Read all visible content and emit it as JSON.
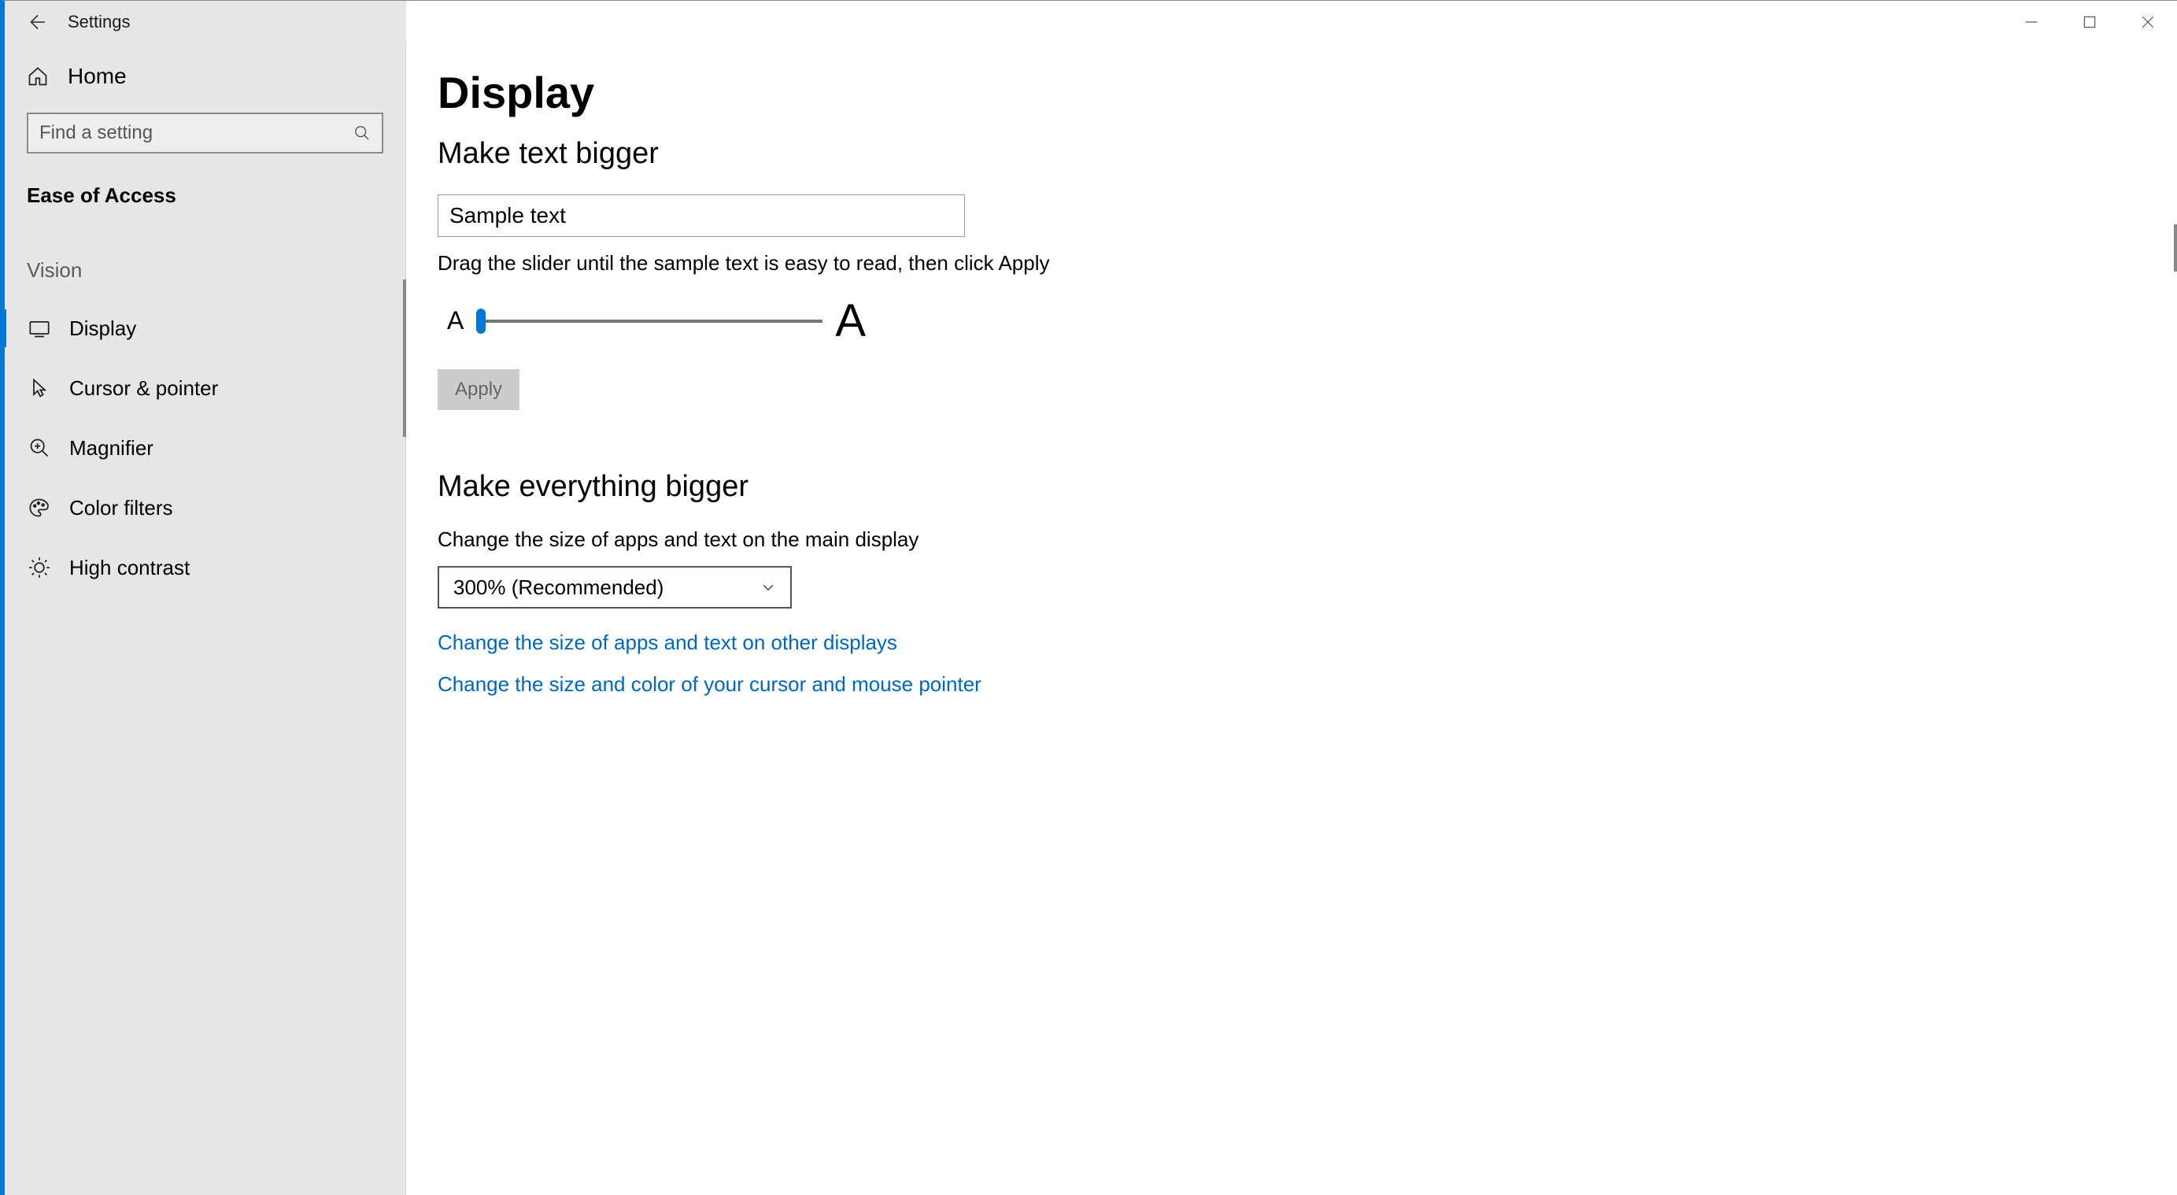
{
  "titlebar": {
    "app_title": "Settings"
  },
  "sidebar": {
    "home_label": "Home",
    "search_placeholder": "Find a setting",
    "category": "Ease of Access",
    "section_vision": "Vision",
    "items": [
      {
        "label": "Display",
        "active": true
      },
      {
        "label": "Cursor & pointer",
        "active": false
      },
      {
        "label": "Magnifier",
        "active": false
      },
      {
        "label": "Color filters",
        "active": false
      },
      {
        "label": "High contrast",
        "active": false
      }
    ]
  },
  "content": {
    "page_title": "Display",
    "section1": {
      "heading": "Make text bigger",
      "sample_text": "Sample text",
      "instruction": "Drag the slider until the sample text is easy to read, then click Apply",
      "small_a": "A",
      "big_a": "A",
      "apply_label": "Apply"
    },
    "section2": {
      "heading": "Make everything bigger",
      "label": "Change the size of apps and text on the main display",
      "dropdown_value": "300% (Recommended)",
      "link1": "Change the size of apps and text on other displays",
      "link2": "Change the size and color of your cursor and mouse pointer"
    }
  }
}
